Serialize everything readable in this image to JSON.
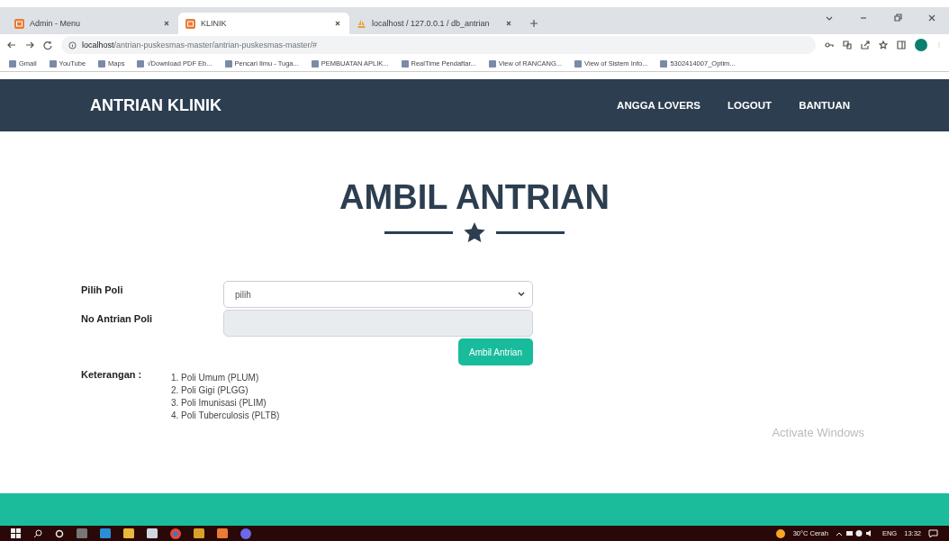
{
  "browser": {
    "tabs": [
      {
        "title": "Admin - Menu",
        "selected": false,
        "kind": "app"
      },
      {
        "title": "KLINIK",
        "selected": true,
        "kind": "app"
      },
      {
        "title": "localhost / 127.0.0.1 / db_antrian",
        "selected": false,
        "kind": "db"
      }
    ],
    "address": {
      "host": "localhost",
      "path": "/antrian-puskesmas-master/antrian-puskesmas-master/#"
    },
    "bookmarks": [
      "Gmail",
      "YouTube",
      "Maps",
      "√Download PDF Eb...",
      "Pencari Ilmu - Tuga...",
      "PEMBUATAN APLIK...",
      "RealTime Pendaftar...",
      "View of RANCANG...",
      "View of Sistem Info...",
      "5302414007_Optim..."
    ]
  },
  "navbar": {
    "brand": "ANTRIAN KLINIK",
    "links": [
      "ANGGA LOVERS",
      "LOGOUT",
      "BANTUAN"
    ]
  },
  "page": {
    "heading": "AMBIL ANTRIAN",
    "fields": [
      {
        "label": "Pilih Poli",
        "kind": "select",
        "value": "pilih"
      },
      {
        "label": "No Antrian Poli",
        "kind": "input",
        "disabled": true
      }
    ],
    "button": "Ambil Antrian",
    "notes": {
      "label": "Keterangan :",
      "items": [
        "1. Poli Umum (PLUM)",
        "2. Poli Gigi (PLGG)",
        "3. Poli Imunisasi (PLIM)",
        "4. Poli Tuberculosis (PLTB)"
      ]
    }
  },
  "activation": "Activate Windows",
  "taskbar": {
    "weather": "30°C Cerah",
    "language": "ENG",
    "time": "13:32"
  }
}
